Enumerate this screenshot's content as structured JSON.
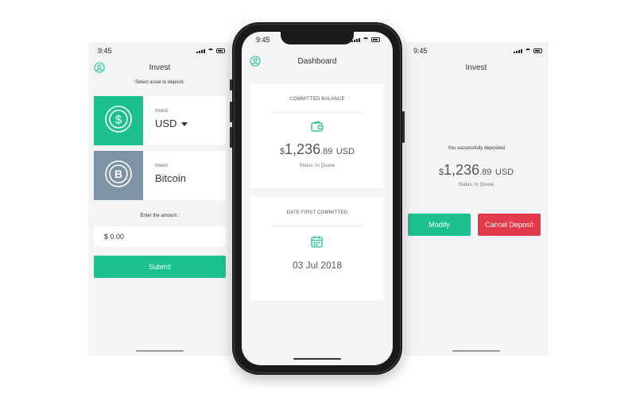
{
  "left": {
    "time": "9:45",
    "title": "Invest",
    "prompt": "Select asset to deposit:",
    "assets": [
      {
        "small": "Invest",
        "name": "USD",
        "tile_color": "#1dc18f",
        "icon": "dollar-coin-icon"
      },
      {
        "small": "Invest",
        "name": "Bitcoin",
        "tile_color": "#7f93a6",
        "icon": "bitcoin-coin-icon"
      }
    ],
    "amount_label": "Enter the amount :",
    "amount_value": "$ 0.00",
    "submit_label": "Submit"
  },
  "center": {
    "time": "9:45",
    "title": "Dashboard",
    "balance_card": {
      "heading": "COMMITTED BALANCE",
      "icon": "wallet-icon",
      "currency_symbol": "$",
      "amount_int": "1,236",
      "amount_dec": ".89",
      "unit": "USD",
      "status": "Status: In Queue"
    },
    "date_card": {
      "heading": "DATE FIRST COMMITTED",
      "icon": "calendar-icon",
      "date": "03 Jul 2018"
    }
  },
  "right": {
    "time": "9:45",
    "title": "Invest",
    "message": "You successfully deposited",
    "currency_symbol": "$",
    "amount_int": "1,236",
    "amount_dec": ".89",
    "unit": "USD",
    "status": "Status: In Queue",
    "modify_label": "Modify",
    "cancel_label": "Cancel Deposit"
  },
  "colors": {
    "accent_green": "#1dc18f",
    "danger_red": "#e33b4b",
    "screen_bg": "#f2f4f6",
    "bitcoin_tile": "#7f93a6"
  }
}
